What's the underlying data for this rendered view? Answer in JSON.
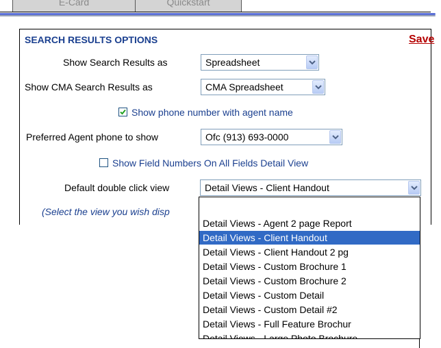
{
  "tabs": [
    "E-Card",
    "Quickstart"
  ],
  "panel": {
    "title": "SEARCH RESULTS OPTIONS",
    "save_label": "Save"
  },
  "fields": {
    "search_results_label": "Show Search Results as",
    "search_results_value": "Spreadsheet",
    "cma_results_label": "Show CMA Search Results as",
    "cma_results_value": "CMA Spreadsheet",
    "phone_checkbox_label": "Show phone number with agent name",
    "phone_checkbox_checked": true,
    "preferred_phone_label": "Preferred Agent phone to show",
    "preferred_phone_value": "Ofc (913) 693-0000",
    "field_numbers_label": "Show Field Numbers On All Fields Detail View",
    "field_numbers_checked": false,
    "double_click_label": "Default double click view",
    "double_click_value": "Detail Views - Client Handout",
    "hint": "(Select the view you wish disp"
  },
  "dropdown": {
    "options": [
      "",
      "Detail Views - Agent 2 page Report",
      "Detail Views - Client Handout",
      "Detail Views - Client Handout 2 pg",
      "Detail Views - Custom Brochure 1",
      "Detail Views - Custom Brochure 2",
      "Detail Views - Custom Detail",
      "Detail Views - Custom Detail #2",
      "Detail Views - Full Feature Brochur",
      "Detail Views - Large Photo Brochure"
    ],
    "highlighted_index": 2
  },
  "colors": {
    "heading": "#1a3f8f",
    "save": "#b50000",
    "highlight": "#316ac5"
  }
}
